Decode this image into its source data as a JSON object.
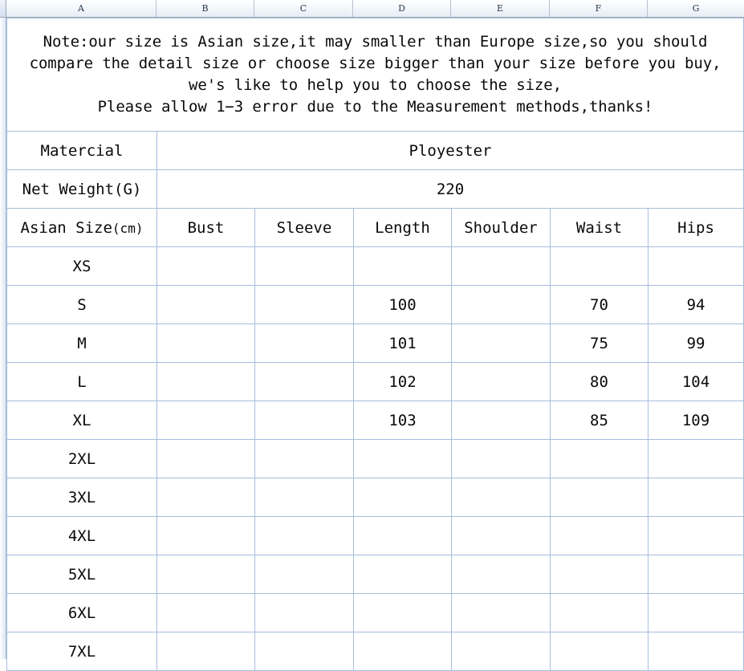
{
  "spreadsheet": {
    "column_headers": [
      "A",
      "B",
      "C",
      "D",
      "E",
      "F",
      "G"
    ],
    "colors": {
      "gridline": "#a8bcdd",
      "header_band_border": "#9aa7b5",
      "text": "#0a0a0a",
      "header_text": "#25374d",
      "cell_background": "#ffffff"
    }
  },
  "note": {
    "lines": [
      "Note:our size is Asian size,it may smaller than Europe size,so you should",
      "compare the detail size or choose size bigger than your size before you buy,",
      "we's like to help you to choose the size,",
      "Please allow 1−3 error due to the Measurement methods,thanks!"
    ]
  },
  "info_rows": [
    {
      "label": "Matercial",
      "value": "Ployester"
    },
    {
      "label": "Net Weight(G)",
      "value": "220"
    }
  ],
  "size_table": {
    "headers": [
      "Asian Size(cm)",
      "Bust",
      "Sleeve",
      "Length",
      "Shoulder",
      "Waist",
      "Hips"
    ],
    "first_header_main": "Asian Size",
    "first_header_unit": "(cm)",
    "rows": [
      {
        "size": "XS",
        "bust": "",
        "sleeve": "",
        "length": "",
        "shoulder": "",
        "waist": "",
        "hips": ""
      },
      {
        "size": "S",
        "bust": "",
        "sleeve": "",
        "length": "100",
        "shoulder": "",
        "waist": "70",
        "hips": "94"
      },
      {
        "size": "M",
        "bust": "",
        "sleeve": "",
        "length": "101",
        "shoulder": "",
        "waist": "75",
        "hips": "99"
      },
      {
        "size": "L",
        "bust": "",
        "sleeve": "",
        "length": "102",
        "shoulder": "",
        "waist": "80",
        "hips": "104"
      },
      {
        "size": "XL",
        "bust": "",
        "sleeve": "",
        "length": "103",
        "shoulder": "",
        "waist": "85",
        "hips": "109"
      },
      {
        "size": "2XL",
        "bust": "",
        "sleeve": "",
        "length": "",
        "shoulder": "",
        "waist": "",
        "hips": ""
      },
      {
        "size": "3XL",
        "bust": "",
        "sleeve": "",
        "length": "",
        "shoulder": "",
        "waist": "",
        "hips": ""
      },
      {
        "size": "4XL",
        "bust": "",
        "sleeve": "",
        "length": "",
        "shoulder": "",
        "waist": "",
        "hips": ""
      },
      {
        "size": "5XL",
        "bust": "",
        "sleeve": "",
        "length": "",
        "shoulder": "",
        "waist": "",
        "hips": ""
      },
      {
        "size": "6XL",
        "bust": "",
        "sleeve": "",
        "length": "",
        "shoulder": "",
        "waist": "",
        "hips": ""
      },
      {
        "size": "7XL",
        "bust": "",
        "sleeve": "",
        "length": "",
        "shoulder": "",
        "waist": "",
        "hips": ""
      }
    ]
  }
}
